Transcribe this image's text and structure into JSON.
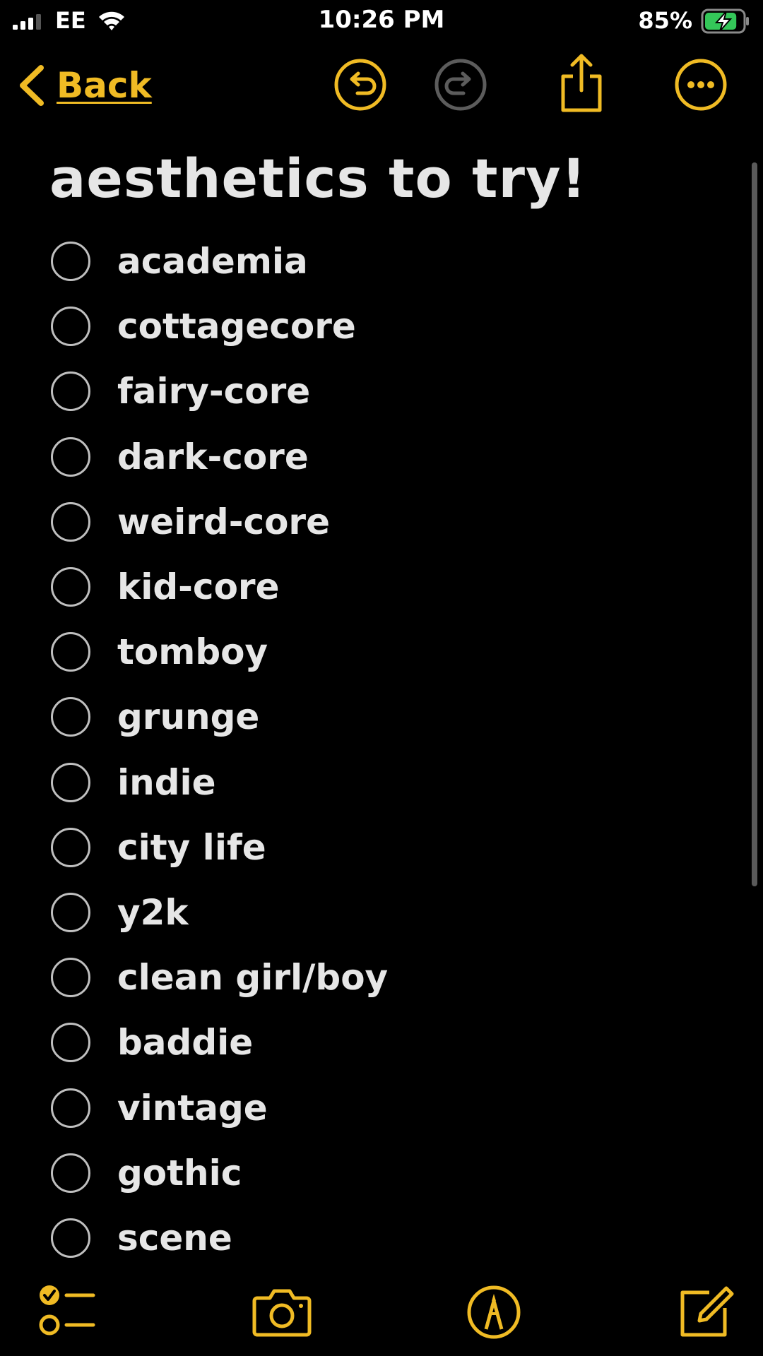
{
  "status_bar": {
    "carrier": "EE",
    "time": "10:26 PM",
    "battery_percent": "85%",
    "battery_level": 0.85,
    "charging": true,
    "signal_bars": 3
  },
  "nav": {
    "back_label": "Back",
    "icons": [
      "chevron-left-icon",
      "undo-icon",
      "redo-icon",
      "share-icon",
      "more-icon"
    ]
  },
  "note": {
    "title": "aesthetics to try!",
    "items": [
      {
        "label": "academia",
        "checked": false
      },
      {
        "label": "cottagecore",
        "checked": false
      },
      {
        "label": "fairy-core",
        "checked": false
      },
      {
        "label": "dark-core",
        "checked": false
      },
      {
        "label": "weird-core",
        "checked": false
      },
      {
        "label": "kid-core",
        "checked": false
      },
      {
        "label": "tomboy",
        "checked": false
      },
      {
        "label": "grunge",
        "checked": false
      },
      {
        "label": "indie",
        "checked": false
      },
      {
        "label": "city life",
        "checked": false
      },
      {
        "label": "y2k",
        "checked": false
      },
      {
        "label": "clean girl/boy",
        "checked": false
      },
      {
        "label": "baddie",
        "checked": false
      },
      {
        "label": "vintage",
        "checked": false
      },
      {
        "label": "gothic",
        "checked": false
      },
      {
        "label": "scene",
        "checked": false
      }
    ]
  },
  "toolbar": {
    "icons": [
      "checklist-icon",
      "camera-icon",
      "markup-pen-icon",
      "compose-icon"
    ]
  },
  "colors": {
    "accent": "#f0bb24",
    "background": "#000000",
    "text": "#e6e6e6",
    "disabled_icon": "#5c5c5c",
    "battery_fill": "#34c759"
  }
}
